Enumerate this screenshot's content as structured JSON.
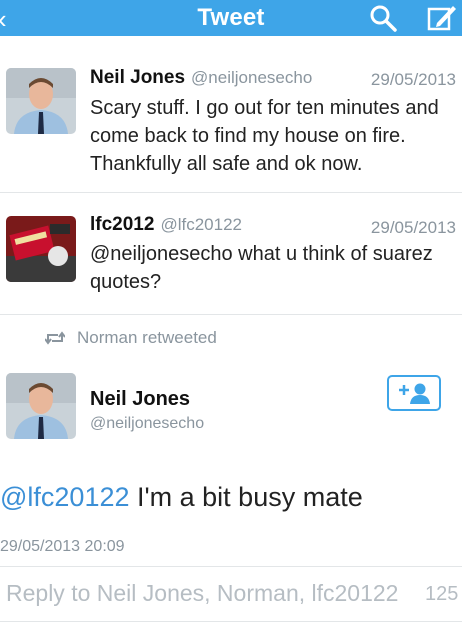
{
  "header": {
    "back_icon": "chevron-left-icon",
    "title": "Tweet",
    "search_icon": "search-icon",
    "compose_icon": "compose-icon"
  },
  "tweets": [
    {
      "name": "Neil Jones",
      "handle": "@neiljonesecho",
      "date": "29/05/2013",
      "text": "Scary stuff. I go out for ten minutes and come back to find my house on fire. Thankfully all safe and ok now."
    },
    {
      "name": "lfc2012",
      "handle": "@lfc20122",
      "date": "29/05/2013",
      "text": "@neiljonesecho what u think of suarez quotes?"
    }
  ],
  "retweet_banner": {
    "icon": "retweet-icon",
    "text": "Norman retweeted"
  },
  "detail": {
    "name": "Neil Jones",
    "handle": "@neiljonesecho",
    "follow_icon": "add-user-icon",
    "mention": "@lfc20122",
    "text": " I'm a bit busy mate",
    "timestamp": "29/05/2013 20:09"
  },
  "reply": {
    "placeholder": "Reply to Neil Jones, Norman, lfc20122",
    "char_count": "125"
  },
  "colors": {
    "header": "#3ea5e8",
    "mention": "#3b8fd6",
    "muted": "#8a959e"
  }
}
